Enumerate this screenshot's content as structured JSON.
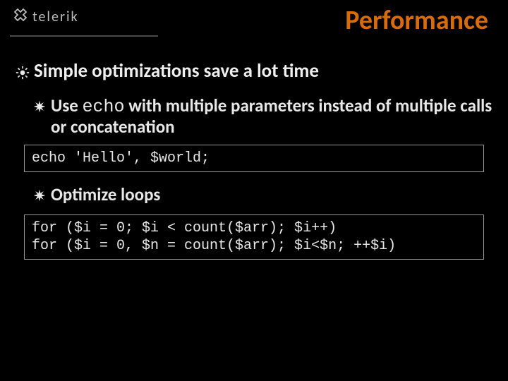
{
  "header": {
    "brand": "telerik",
    "title": "Performance"
  },
  "bullets": {
    "level1": "Simple optimizations save a lot time",
    "level2a_pre": "Use ",
    "level2a_code": "echo",
    "level2a_post": " with multiple parameters instead of multiple calls or concatenation",
    "level2b": "Optimize loops"
  },
  "code": {
    "echo": "echo 'Hello', $world;",
    "loops": "for ($i = 0; $i < count($arr); $i++)\nfor ($i = 0, $n = count($arr); $i<$n; ++$i)"
  }
}
